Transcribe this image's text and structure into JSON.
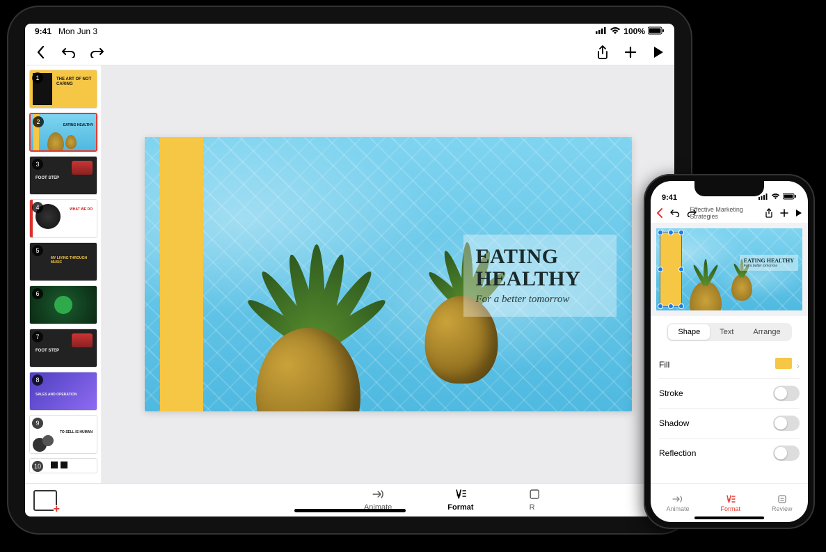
{
  "ipad": {
    "status": {
      "time": "9:41",
      "date": "Mon Jun 3",
      "battery": "100%"
    },
    "thumbnails": [
      {
        "num": 1,
        "title": "THE ART OF NOT CARING"
      },
      {
        "num": 2,
        "title": "EATING HEALTHY"
      },
      {
        "num": 3,
        "title": "FOOT STEP"
      },
      {
        "num": 4,
        "title": "WHAT WE DO"
      },
      {
        "num": 5,
        "title": "MY LIVING THROUGH MUSIC"
      },
      {
        "num": 6,
        "title": ""
      },
      {
        "num": 7,
        "title": "FOOT STEP"
      },
      {
        "num": 8,
        "title": "SALES AND OPERATION"
      },
      {
        "num": 9,
        "title": "TO SELL IS HUMAN"
      },
      {
        "num": 10,
        "title": ""
      }
    ],
    "slide": {
      "heading_line1": "EATING",
      "heading_line2": "HEALTHY",
      "sub": "For a better tomorrow"
    },
    "bottomTabs": {
      "animate": "Animate",
      "format": "Format",
      "review": "Review"
    }
  },
  "iphone": {
    "status_time": "9:41",
    "doc_title": "Effective Marketing Strategies",
    "slide": {
      "heading": "EATING HEALTHY",
      "sub": "For a better tomorrow"
    },
    "segments": {
      "shape": "Shape",
      "text": "Text",
      "arrange": "Arrange"
    },
    "rows": {
      "fill": "Fill",
      "stroke": "Stroke",
      "shadow": "Shadow",
      "reflection": "Reflection"
    },
    "tabs": {
      "animate": "Animate",
      "format": "Format",
      "review": "Review"
    },
    "colors": {
      "accent": "#f6c645"
    }
  }
}
